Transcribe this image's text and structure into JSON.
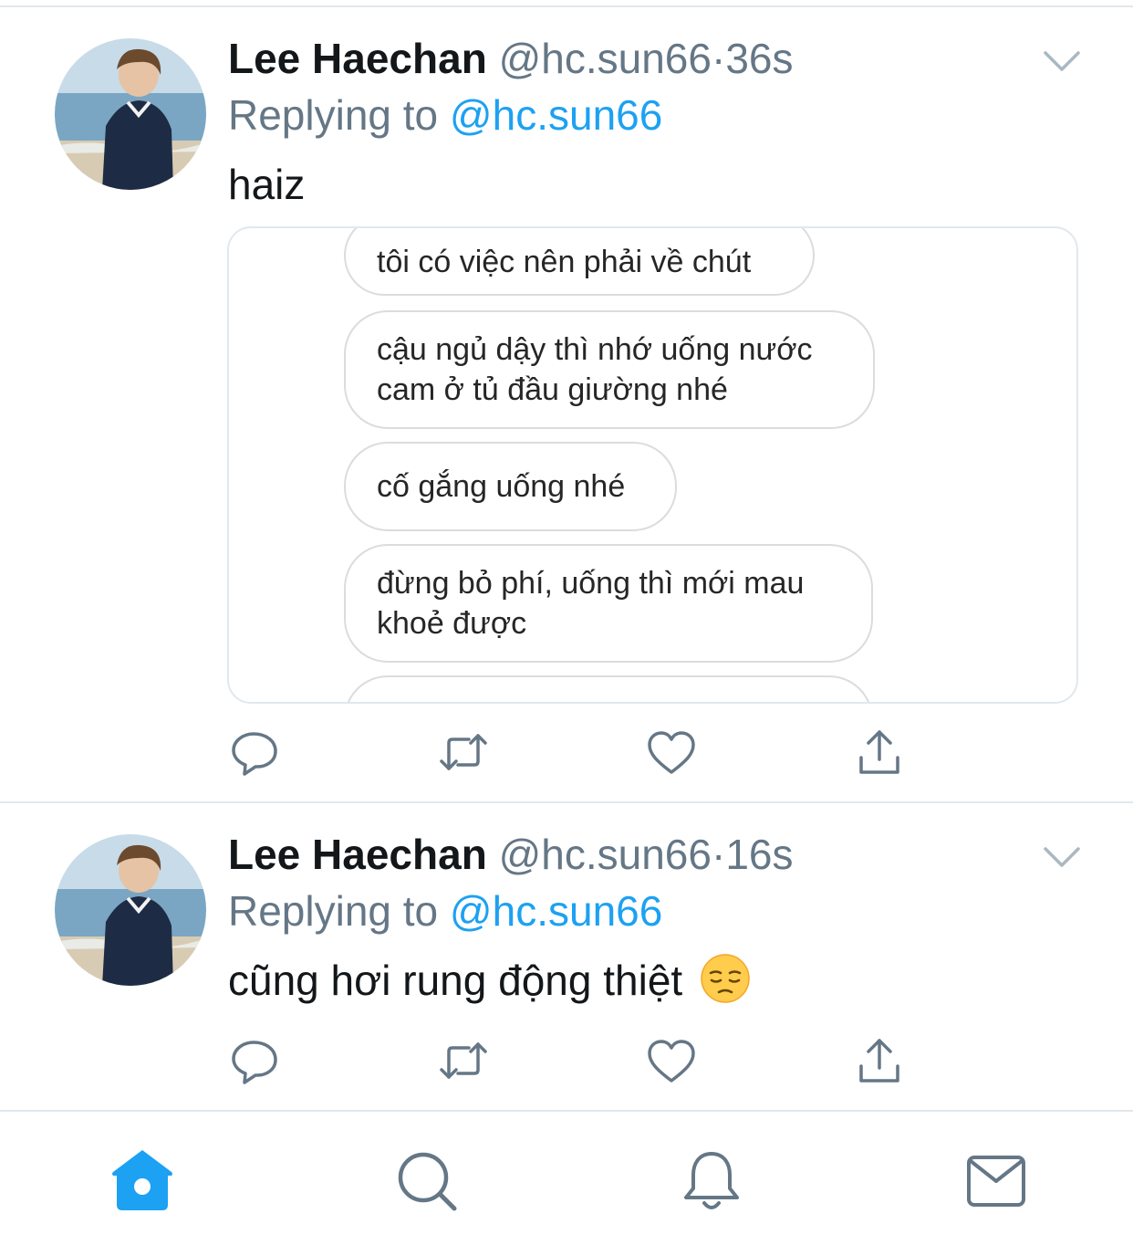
{
  "tweets": [
    {
      "name": "Lee Haechan",
      "handle": "@hc.sun66",
      "separator": "·",
      "time": "36s",
      "replying_prefix": "Replying to",
      "replying_handle": "@hc.sun66",
      "text": "haiz",
      "media_messages": [
        "tôi có việc nên phải về chút",
        "cậu ngủ dậy thì nhớ uống nước cam ở tủ đầu giường nhé",
        "cố gắng uống nhé",
        "đừng bỏ phí, uống thì mới mau khoẻ được"
      ],
      "icons": {
        "reply": "reply-icon",
        "retweet": "retweet-icon",
        "like": "heart-icon",
        "share": "share-icon",
        "menu": "chevron-down-icon"
      }
    },
    {
      "name": "Lee Haechan",
      "handle": "@hc.sun66",
      "separator": "·",
      "time": "16s",
      "replying_prefix": "Replying to",
      "replying_handle": "@hc.sun66",
      "text": "cũng hơi rung động thiệt",
      "emoji": "pensive-face",
      "icons": {
        "reply": "reply-icon",
        "retweet": "retweet-icon",
        "like": "heart-icon",
        "share": "share-icon",
        "menu": "chevron-down-icon"
      }
    }
  ],
  "tabbar": {
    "items": [
      {
        "id": "home",
        "icon": "home-icon",
        "active": true
      },
      {
        "id": "search",
        "icon": "search-icon",
        "active": false
      },
      {
        "id": "notifications",
        "icon": "bell-icon",
        "active": false
      },
      {
        "id": "messages",
        "icon": "mail-icon",
        "active": false
      }
    ]
  },
  "colors": {
    "accent": "#1da1f2",
    "secondary_text": "#657786",
    "primary_text": "#14171a",
    "divider": "#e1e8ed",
    "icon_gray": "#657786"
  }
}
